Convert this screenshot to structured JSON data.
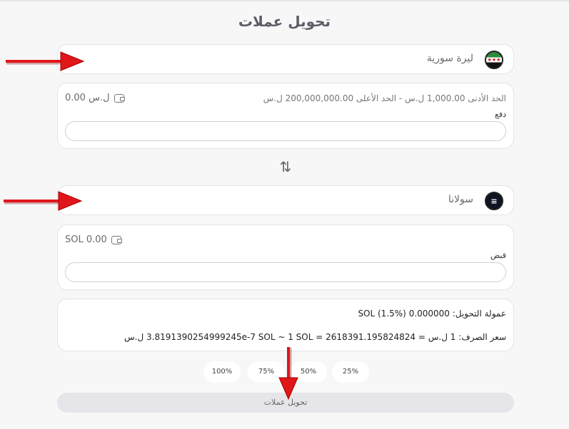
{
  "page": {
    "title": "تحويل عملات"
  },
  "from_currency": {
    "name": "ليرة سورية",
    "icon": "syria-flag-icon"
  },
  "from_card": {
    "balance": "0.00 ل.س",
    "limits": "الحد الأدنى 1,000.00 ل.س   -   الحد الأعلى 200,000,000.00 ل.س",
    "field_label": "دفع",
    "value": ""
  },
  "to_currency": {
    "name": "سولانا",
    "icon": "solana-icon"
  },
  "to_card": {
    "balance": "SOL 0.00",
    "field_label": "قبض",
    "value": ""
  },
  "info": {
    "fee": "عمولة التحويل: 0.000000 SOL (1.5%)",
    "rate": "سعر الصرف: 1 ل.س = 3.8191390254999245e-7 SOL ~ 1 SOL = 2618391.195824824 ل.س"
  },
  "percent_buttons": [
    "25%",
    "50%",
    "75%",
    "100%"
  ],
  "convert_button": "تحويل عملات",
  "colors": {
    "annotation_arrow": "#e0161b"
  }
}
